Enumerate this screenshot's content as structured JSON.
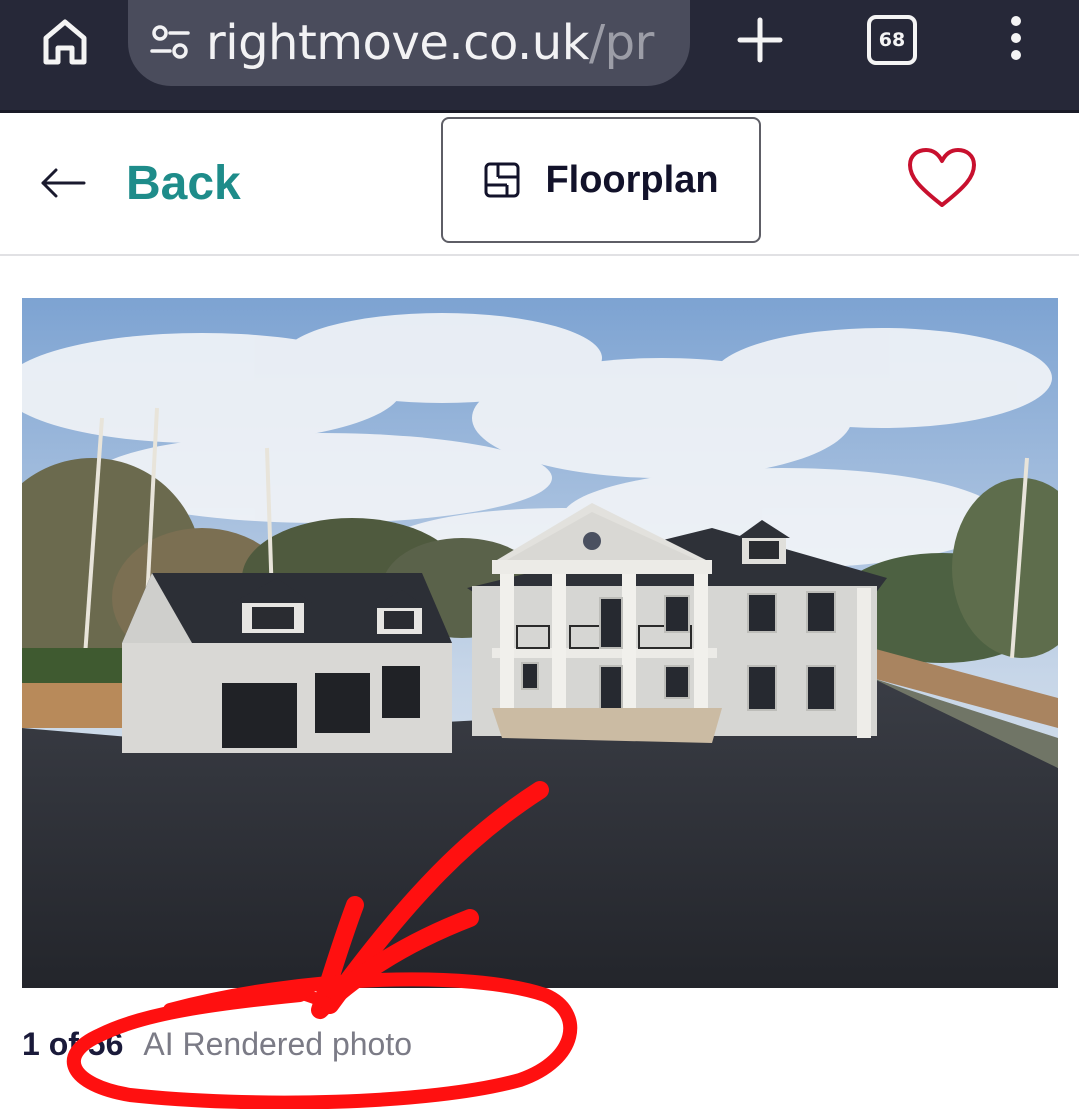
{
  "browser": {
    "url_domain": "rightmove.co.uk",
    "url_rest": "/pr",
    "tab_count": "68",
    "icons": [
      "home-icon",
      "site-settings-icon",
      "new-tab-icon",
      "tab-switcher-icon",
      "more-menu-icon"
    ],
    "chrome_color": "#262838"
  },
  "header": {
    "back_label": "Back",
    "floorplan_label": "Floorplan",
    "accent_color": "#1e8c8a",
    "heart_color": "#c8102e"
  },
  "gallery": {
    "counter": "1 of 56",
    "photo_label": "AI Rendered photo"
  },
  "annotation": {
    "color": "#ff0000",
    "shapes": [
      "arrow",
      "circle"
    ]
  }
}
